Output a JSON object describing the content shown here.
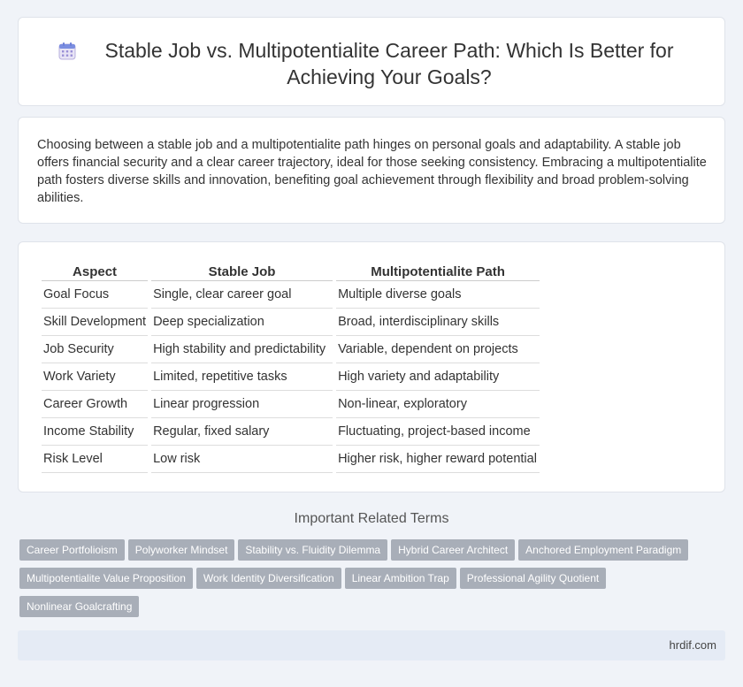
{
  "header": {
    "icon": "calendar-icon",
    "title": "Stable Job vs. Multipotentialite Career Path: Which Is Better for Achieving Your Goals?"
  },
  "intro": {
    "text": "Choosing between a stable job and a multipotentialite path hinges on personal goals and adaptability. A stable job offers financial security and a clear career trajectory, ideal for those seeking consistency. Embracing a multipotentialite path fosters diverse skills and innovation, benefiting goal achievement through flexibility and broad problem-solving abilities."
  },
  "table": {
    "headers": [
      "Aspect",
      "Stable Job",
      "Multipotentialite Path"
    ],
    "rows": [
      [
        "Goal Focus",
        "Single, clear career goal",
        "Multiple diverse goals"
      ],
      [
        "Skill Development",
        "Deep specialization",
        "Broad, interdisciplinary skills"
      ],
      [
        "Job Security",
        "High stability and predictability",
        "Variable, dependent on projects"
      ],
      [
        "Work Variety",
        "Limited, repetitive tasks",
        "High variety and adaptability"
      ],
      [
        "Career Growth",
        "Linear progression",
        "Non-linear, exploratory"
      ],
      [
        "Income Stability",
        "Regular, fixed salary",
        "Fluctuating, project-based income"
      ],
      [
        "Risk Level",
        "Low risk",
        "Higher risk, higher reward potential"
      ]
    ]
  },
  "related": {
    "title": "Important Related Terms",
    "tags": [
      "Career Portfolioism",
      "Polyworker Mindset",
      "Stability vs. Fluidity Dilemma",
      "Hybrid Career Architect",
      "Anchored Employment Paradigm",
      "Multipotentialite Value Proposition",
      "Work Identity Diversification",
      "Linear Ambition Trap",
      "Professional Agility Quotient",
      "Nonlinear Goalcrafting"
    ]
  },
  "footer": {
    "site": "hrdif.com"
  }
}
